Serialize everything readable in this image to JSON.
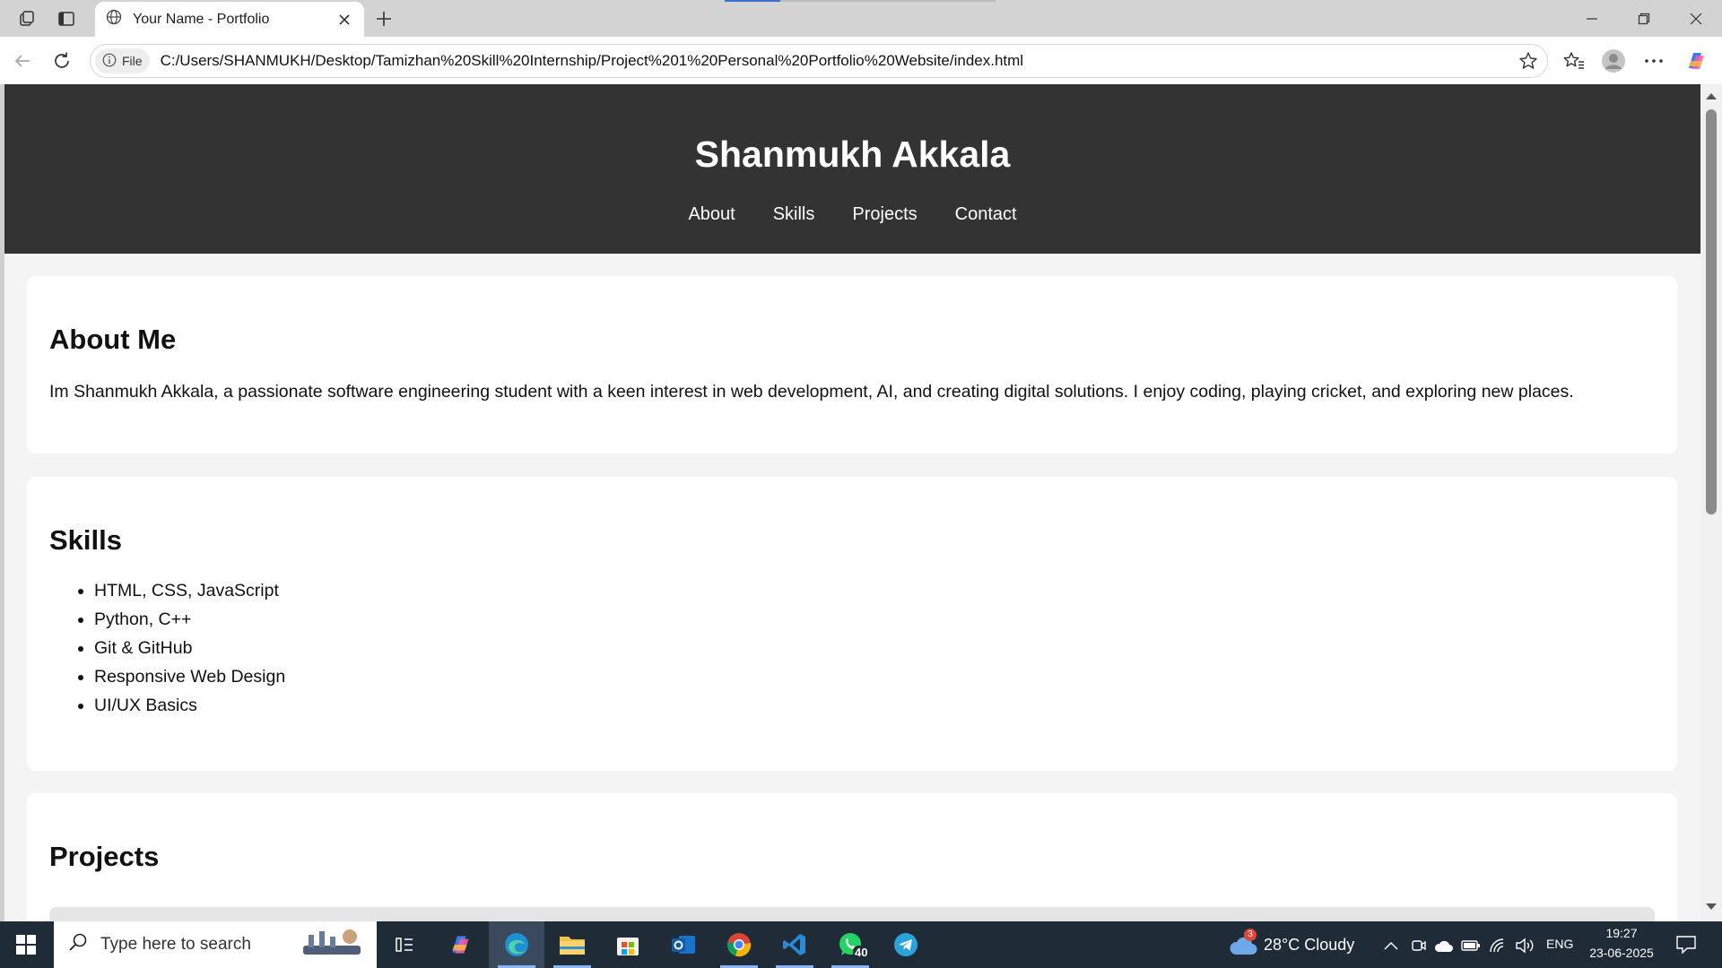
{
  "browser": {
    "tab_title": "Your Name - Portfolio",
    "file_chip": "File",
    "url": "C:/Users/SHANMUKH/Desktop/Tamizhan%20Skill%20Internship/Project%201%20Personal%20Portfolio%20Website/index.html"
  },
  "page": {
    "site_name": "Shanmukh Akkala",
    "nav": [
      "About",
      "Skills",
      "Projects",
      "Contact"
    ],
    "about": {
      "heading": "About Me",
      "text": "Im Shanmukh Akkala, a passionate software engineering student with a keen interest in web development, AI, and creating digital solutions. I enjoy coding, playing cricket, and exploring new places."
    },
    "skills": {
      "heading": "Skills",
      "items": [
        "HTML, CSS, JavaScript",
        "Python, C++",
        "Git & GitHub",
        "Responsive Web Design",
        "UI/UX Basics"
      ]
    },
    "projects": {
      "heading": "Projects"
    }
  },
  "taskbar": {
    "search_placeholder": "Type here to search",
    "weather": "28°C  Cloudy",
    "weather_badge": "3",
    "whatsapp_badge": "40",
    "language": "ENG",
    "time": "19:27",
    "date": "23-06-2025"
  },
  "colors": {
    "header_bg": "#333333",
    "page_bg": "#f4f4f4",
    "taskbar_bg": "#202b38"
  }
}
